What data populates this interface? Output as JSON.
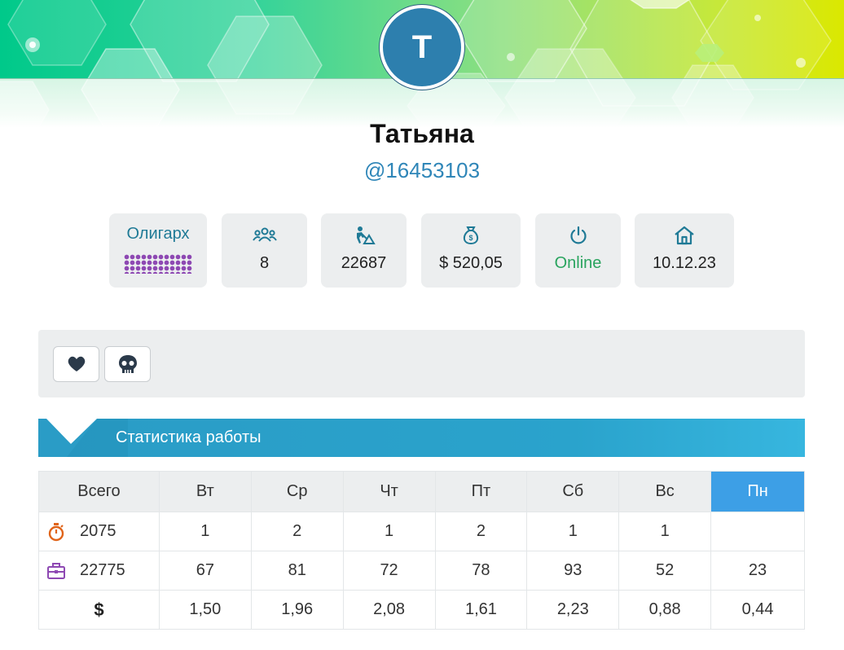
{
  "profile": {
    "avatar_letter": "T",
    "name": "Татьяна",
    "handle": "@16453103"
  },
  "stats_cards": {
    "rank": {
      "title": "Олигарх",
      "rank_dots_icon": "rank-dots"
    },
    "referrals": {
      "icon": "users-icon",
      "value": "8"
    },
    "work": {
      "icon": "worker-icon",
      "value": "22687"
    },
    "balance": {
      "icon": "money-bag-icon",
      "value": "$ 520,05"
    },
    "status": {
      "icon": "power-icon",
      "value": "Online"
    },
    "registered": {
      "icon": "home-icon",
      "value": "10.12.23"
    }
  },
  "actions": {
    "like_icon": "heart-icon",
    "report_icon": "skull-icon"
  },
  "section": {
    "title": "Статистика работы"
  },
  "table": {
    "headers": [
      "Всего",
      "Вт",
      "Ср",
      "Чт",
      "Пт",
      "Сб",
      "Вс",
      "Пн"
    ],
    "rows": [
      {
        "icon": "stopwatch-icon",
        "total": "2075",
        "values": [
          "1",
          "2",
          "1",
          "2",
          "1",
          "1",
          ""
        ]
      },
      {
        "icon": "briefcase-icon",
        "total": "22775",
        "values": [
          "67",
          "81",
          "72",
          "78",
          "93",
          "52",
          "23"
        ]
      },
      {
        "icon": "dollar-sign",
        "total": "$",
        "values": [
          "1,50",
          "1,96",
          "2,08",
          "1,61",
          "2,23",
          "0,88",
          "0,44"
        ]
      }
    ]
  },
  "colors": {
    "accent": "#2aa3cc",
    "today_header": "#3d9fe6",
    "online": "#2aa45f",
    "avatar": "#2d7fae",
    "rank_dots": "#8e49b3"
  }
}
